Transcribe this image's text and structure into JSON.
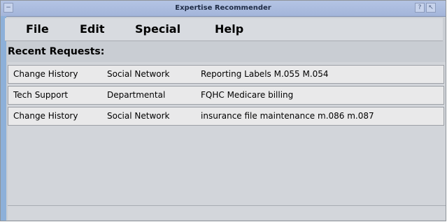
{
  "window": {
    "title": "Expertise Recommender",
    "left_button": "−",
    "right_buttons": [
      "?",
      "↖"
    ]
  },
  "menu": [
    {
      "label": "File"
    },
    {
      "label": "Edit"
    },
    {
      "label": "Special"
    },
    {
      "label": "Help"
    }
  ],
  "recent_requests": {
    "title": "Recent Requests:",
    "rows": [
      {
        "category": "Change History",
        "network": "Social Network",
        "description": "Reporting Labels M.055 M.054"
      },
      {
        "category": "Tech Support",
        "network": "Departmental",
        "description": "FQHC Medicare billing"
      },
      {
        "category": "Change History",
        "network": "Social Network",
        "description": "insurance file maintenance m.086 m.087"
      }
    ]
  },
  "colors": {
    "titlebar": "#a3b5da",
    "window_bg": "#c9cdd3",
    "row_bg": "#e9e9ea"
  }
}
